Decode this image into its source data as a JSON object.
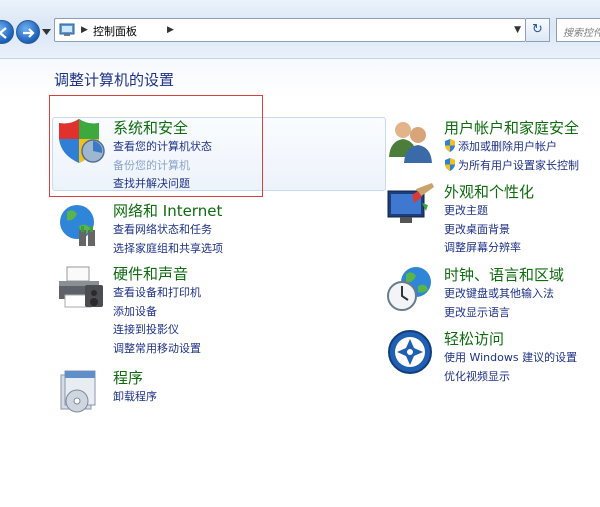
{
  "window": {
    "breadcrumb": "控制面板",
    "search_placeholder": "搜索控件",
    "refresh_glyph": "↻"
  },
  "page": {
    "title": "调整计算机的设置"
  },
  "left_categories": [
    {
      "title": "系统和安全",
      "icon": "shield-security-icon",
      "links": [
        "查看您的计算机状态",
        "备份您的计算机",
        "查找并解决问题"
      ]
    },
    {
      "title": "网络和 Internet",
      "icon": "network-globe-icon",
      "links": [
        "查看网络状态和任务",
        "选择家庭组和共享选项"
      ]
    },
    {
      "title": "硬件和声音",
      "icon": "printer-icon",
      "links": [
        "查看设备和打印机",
        "添加设备",
        "连接到投影仪",
        "调整常用移动设置"
      ]
    },
    {
      "title": "程序",
      "icon": "programs-icon",
      "links": [
        "卸载程序"
      ]
    }
  ],
  "right_categories": [
    {
      "title": "用户帐户和家庭安全",
      "icon": "users-icon",
      "links": [
        "添加或删除用户帐户",
        "为所有用户设置家长控制"
      ]
    },
    {
      "title": "外观和个性化",
      "icon": "display-paint-icon",
      "links": [
        "更改主题",
        "更改桌面背景",
        "调整屏幕分辨率"
      ]
    },
    {
      "title": "时钟、语言和区域",
      "icon": "clock-globe-icon",
      "links": [
        "更改键盘或其他输入法",
        "更改显示语言"
      ]
    },
    {
      "title": "轻松访问",
      "icon": "ease-of-access-icon",
      "links": [
        "使用 Windows 建议的设置",
        "优化视频显示"
      ]
    }
  ],
  "colors": {
    "category_title": "#0e6b0e",
    "link": "#1e3287",
    "highlight_border": "#d64040"
  }
}
